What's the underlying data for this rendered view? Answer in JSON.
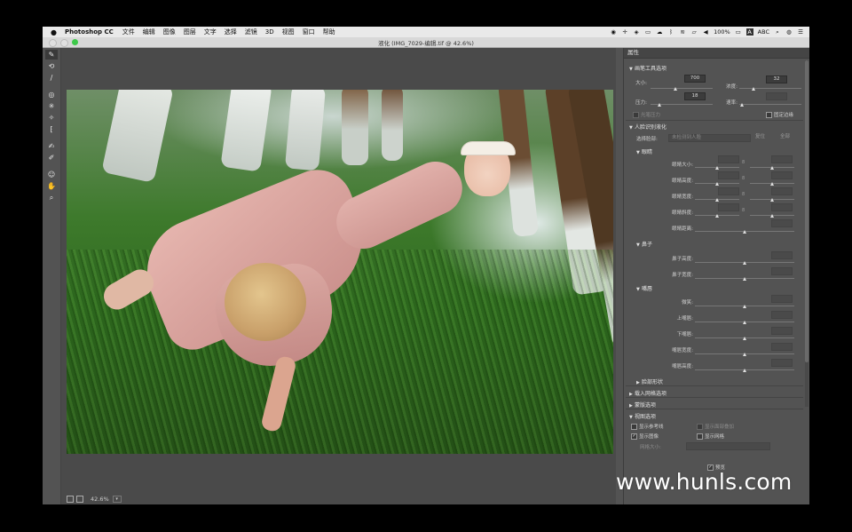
{
  "menubar": {
    "app_name": "Photoshop CC",
    "items": [
      "文件",
      "编辑",
      "图像",
      "图层",
      "文字",
      "选择",
      "滤镜",
      "3D",
      "视图",
      "窗口",
      "帮助"
    ],
    "battery": "100%",
    "input_source": "ABC"
  },
  "window": {
    "title": "液化 (IMG_7029-编辑.tif @ 42.6%)"
  },
  "statusbar": {
    "zoom": "42.6%"
  },
  "panel": {
    "title": "属性",
    "brush_section": {
      "title": "画笔工具选项",
      "size_label": "大小:",
      "size_value": "700",
      "density_label": "浓度:",
      "density_value": "32",
      "pressure_label": "压力:",
      "pressure_value": "18",
      "rate_label": "速率:",
      "rate_value": "",
      "stylus_label": "光笔压力",
      "pin_edges_label": "固定边缘"
    },
    "face_section": {
      "title": "人脸识别液化",
      "select_face_label": "选择脸部:",
      "select_face_value": "未检测到人脸",
      "reset_label": "复位",
      "all_label": "全部",
      "eyes": {
        "title": "眼睛",
        "rows": [
          "眼睛大小:",
          "眼睛高度:",
          "眼睛宽度:",
          "眼睛斜度:",
          "眼睛距离:"
        ]
      },
      "nose": {
        "title": "鼻子",
        "rows": [
          "鼻子高度:",
          "鼻子宽度:"
        ]
      },
      "mouth": {
        "title": "嘴唇",
        "rows": [
          "微笑:",
          "上嘴唇:",
          "下嘴唇:",
          "嘴唇宽度:",
          "嘴唇高度:"
        ]
      },
      "face_shape_title": "脸部形状"
    },
    "load_mesh_title": "载入网格选项",
    "mask_title": "蒙版选项",
    "view_section": {
      "title": "视图选项",
      "show_guides": "显示参考线",
      "show_face_overlay": "显示面部叠加",
      "show_image": "显示图像",
      "show_mesh": "显示网格",
      "mesh_size_label": "网格大小:"
    },
    "preview_label": "预览"
  },
  "watermark": "www.hunls.com"
}
